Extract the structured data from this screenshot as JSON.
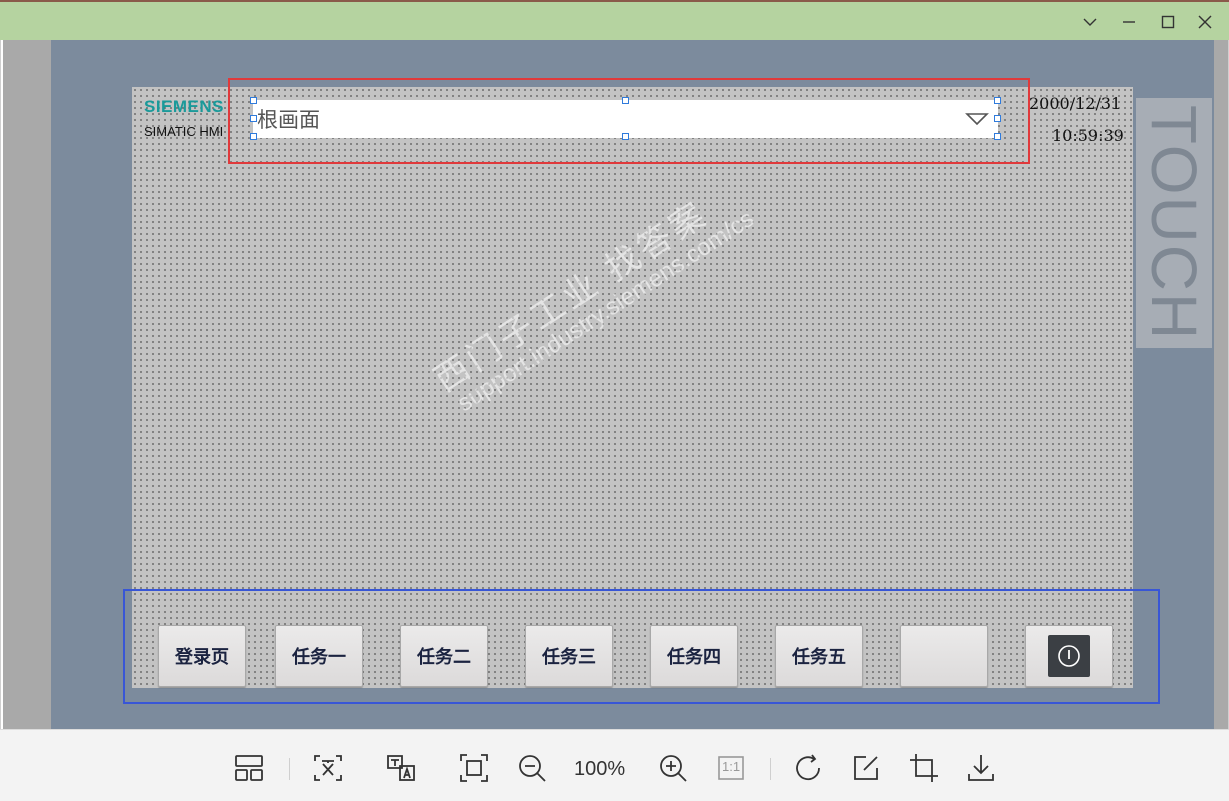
{
  "hmi": {
    "brand": "SIEMENS",
    "product": "SIMATIC HMI",
    "side_label": "TOUCH",
    "date": "2000/12/31",
    "time": "10:59:39",
    "screen_selector": {
      "value": "根画面"
    },
    "buttons": [
      {
        "label": "登录页"
      },
      {
        "label": "任务一"
      },
      {
        "label": "任务二"
      },
      {
        "label": "任务三"
      },
      {
        "label": "任务四"
      },
      {
        "label": "任务五"
      },
      {
        "label": ""
      }
    ]
  },
  "watermark": {
    "line1": "西门子工业  找答案",
    "line2": "support.industry.siemens.com/cs"
  },
  "toolbar": {
    "zoom": "100%",
    "actual_size_label": "1:1"
  },
  "colors": {
    "titlebar": "#b5d3a0",
    "highlight_red": "#e0393b",
    "highlight_blue": "#3856d6",
    "siemens_teal": "#1a9a9a"
  }
}
